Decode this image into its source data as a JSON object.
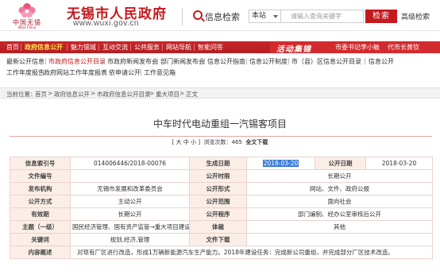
{
  "header": {
    "logo_text": "中国无锡",
    "logo_sub": "Wuxi China",
    "site_title": "无锡市人民政府",
    "site_url": "www.wuxi.gov.cn",
    "search_label": "信息检索",
    "search_scope": "本站",
    "search_placeholder": "请输入查询关键字",
    "search_button": "检索",
    "advanced_search": "高级检索"
  },
  "nav": {
    "items": [
      "首页",
      "政府信息公开",
      "魅力锡城",
      "互动交流",
      "公共服务",
      "网站导航",
      "智能问答"
    ],
    "active_index": 1,
    "slogan": "活动集锦",
    "links": [
      "市委书记李小敏",
      "代市长黄钦"
    ]
  },
  "subnav": {
    "row1": [
      "最新公开信息",
      "市政府信息公开目录",
      "市政府新闻发布会",
      "部门新闻发布会",
      "信息公开指南",
      "信息公开制度",
      "市（县）区信息公开目录",
      "信息公开"
    ],
    "row2": [
      "工作年度报告",
      "政府网站工作年度报表",
      "依申请公开",
      "工作意见箱"
    ]
  },
  "breadcrumb": {
    "prefix": "当前位置：",
    "items": [
      "首页",
      "政府信息公开",
      "市政府信息公开目录",
      "重大项目",
      "正文"
    ],
    "separator": ">"
  },
  "article": {
    "title": "中车时代电动重组一汽锡客项目",
    "font_size_prefix": "[",
    "font_large": "大",
    "font_medium": "中",
    "font_small": "小",
    "font_size_suffix": "]",
    "views_label": "浏览次数：",
    "views_count": "465",
    "download_label": "全文下载"
  },
  "table": {
    "rows": [
      {
        "l1": "信息索引号",
        "v1": "014006446/2018-00076",
        "l2": "生成日期",
        "v2": "2018-03-20",
        "l3": "公开日期",
        "v3": "2018-03-20"
      },
      {
        "l1": "文件编号",
        "v1": "",
        "l2": "公开时限",
        "v2": "长期公开"
      },
      {
        "l1": "发布机构",
        "v1": "无锡市发展和改革委员会",
        "l2": "公开形式",
        "v2": "网站、文件、政府公报"
      },
      {
        "l1": "公开方式",
        "v1": "主动公开",
        "l2": "公开范围",
        "v2": "面向社会"
      },
      {
        "l1": "有效期",
        "v1": "长期公开",
        "l2": "公开程序",
        "v2": "部门编制、经办公室审核后公开"
      },
      {
        "l1": "主题（一级）",
        "v1": "国民经济管理、国有资产监管→重大项目建设",
        "l2": "体裁",
        "v2": "其他"
      },
      {
        "l1": "关键词",
        "v1": "规划,经济,管理",
        "l2": "文件下载",
        "v2": ""
      },
      {
        "l1": "内容概述",
        "v1": "对现有厂区进行改造，形成1万辆新能源汽车生产能力。2018年建设任务：完成新公司重组，并完成部分厂区技术改造。"
      }
    ]
  },
  "colors": {
    "brand_red": "#c4191d",
    "nav_active": "#ffe44d",
    "label_bg": "#fbeee6",
    "highlight": "#3b7bd9"
  }
}
